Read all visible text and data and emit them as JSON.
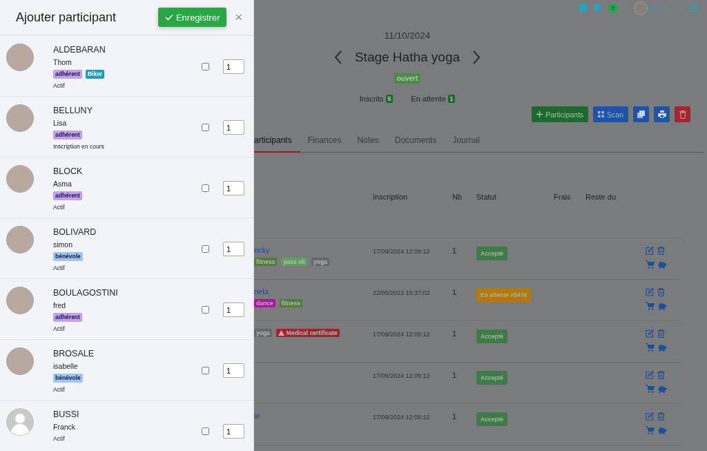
{
  "panel": {
    "title": "Ajouter participant",
    "save_button": "Enregistrer",
    "close": "×",
    "people": [
      {
        "last_name": "ALDEBARAN",
        "first_name": "Thom",
        "photo": true,
        "tags": [
          {
            "label": "adhérent",
            "color": "#c29ffa"
          },
          {
            "label": "Biker",
            "color": "#17a2b8"
          }
        ],
        "status": "Actif",
        "checked": false,
        "quantity": "1"
      },
      {
        "last_name": "BELLUNY",
        "first_name": "Lisa",
        "photo": true,
        "tags": [
          {
            "label": "adhérent",
            "color": "#c29ffa"
          }
        ],
        "status": "Inscription en cours",
        "checked": false,
        "quantity": "1"
      },
      {
        "last_name": "BLOCK",
        "first_name": "Asma",
        "photo": true,
        "tags": [
          {
            "label": "adhérent",
            "color": "#c29ffa"
          }
        ],
        "status": "Actif",
        "checked": false,
        "quantity": "1"
      },
      {
        "last_name": "BOLIVARD",
        "first_name": "simon",
        "photo": true,
        "tags": [
          {
            "label": "bénévole",
            "color": "#9ec5fe"
          }
        ],
        "status": "Actif",
        "checked": false,
        "quantity": "1"
      },
      {
        "last_name": "BOULAGOSTINI",
        "first_name": "fred",
        "photo": true,
        "tags": [
          {
            "label": "adhérent",
            "color": "#c29ffa"
          }
        ],
        "status": "Actif",
        "checked": false,
        "quantity": "1"
      },
      {
        "last_name": "BROSALE",
        "first_name": "isabelle",
        "photo": true,
        "tags": [
          {
            "label": "bénévole",
            "color": "#9ec5fe"
          }
        ],
        "status": "Actif",
        "checked": false,
        "quantity": "1"
      },
      {
        "last_name": "BUSSI",
        "first_name": "Franck",
        "photo": false,
        "status": "Actif",
        "checked": false,
        "quantity": "1"
      }
    ]
  },
  "topbar": {
    "user": "jax teller"
  },
  "event": {
    "date": "11/10/2024",
    "title": "Stage Hatha yoga",
    "state": "ouvert",
    "counters": [
      {
        "label": "Inscrits",
        "count": "5"
      },
      {
        "label": "En attente",
        "count": "1"
      }
    ],
    "add_button": "Participants",
    "scan_button": "Scan"
  },
  "tabs": [
    {
      "label": "articipants",
      "selected": true
    },
    {
      "label": "Finances",
      "selected": false
    },
    {
      "label": "Notes",
      "selected": false
    },
    {
      "label": "Documents",
      "selected": false
    },
    {
      "label": "Journal",
      "selected": false
    }
  ],
  "table": {
    "columns": [
      "Inscription",
      "Nb",
      "Statut",
      "Frais",
      "Reste du"
    ],
    "rows": [
      {
        "name": "ncky",
        "tags": [
          {
            "label": "fitness",
            "color": "#4f7d3c",
            "kind": "plain"
          },
          {
            "label": "pass ok",
            "color": "#5fa060",
            "kind": "plain"
          },
          {
            "label": "yoga",
            "color": "#676869",
            "kind": "plain"
          }
        ],
        "date": "17/09/2024 12:09:12",
        "nb": "1",
        "status": {
          "label": "Accepté",
          "color": "#3f7a48"
        }
      },
      {
        "name": "nela",
        "tags": [
          {
            "label": "dance",
            "color": "#a8169a",
            "kind": "plain"
          },
          {
            "label": "fitness",
            "color": "#4f7d3c",
            "kind": "plain"
          }
        ],
        "date": "22/05/2023 10:37:02",
        "nb": "1",
        "status": {
          "label": "En attente #5474",
          "color": "#b27a0c"
        }
      },
      {
        "tags": [
          {
            "label": "yoga",
            "color": "#676869",
            "kind": "plain"
          },
          {
            "label": "Medical certificate",
            "color": "#a1232e",
            "kind": "warning"
          }
        ],
        "date": "17/09/2024 12:09:12",
        "nb": "1",
        "status": {
          "label": "Accepté",
          "color": "#3f7a48"
        }
      },
      {
        "date": "17/09/2024 12:09:12",
        "nb": "1",
        "status": {
          "label": "Accepté",
          "color": "#3f7a48"
        }
      },
      {
        "name": "ie",
        "date": "17/09/2024 12:09:12",
        "nb": "1",
        "status": {
          "label": "Accepté",
          "color": "#3f7a48"
        }
      }
    ]
  }
}
